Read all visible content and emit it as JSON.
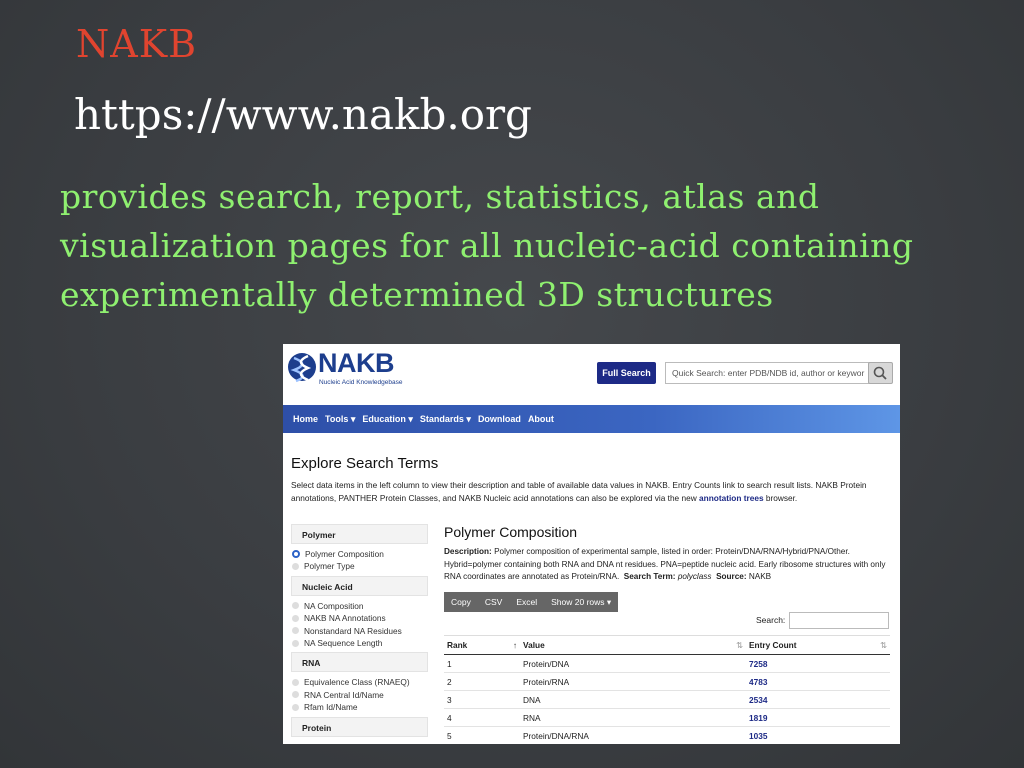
{
  "slide": {
    "title": "NAKB",
    "url": "https://www.nakb.org",
    "description": "provides search, report, statistics, atlas and visualization pages for all nucleic-acid containing experimentally determined 3D structures"
  },
  "app": {
    "logo_text": "NAKB",
    "logo_subtitle": "Nucleic Acid Knowledgebase",
    "full_search_label": "Full Search",
    "quick_search_placeholder": "Quick Search: enter PDB/NDB id, author or keywor",
    "nav": [
      "Home",
      "Tools ▾",
      "Education ▾",
      "Standards ▾",
      "Download",
      "About"
    ],
    "page_title": "Explore Search Terms",
    "intro_text": "Select data items in the left column to view their description and table of available data values in NAKB. Entry Counts link to search result lists. NAKB Protein annotations, PANTHER Protein Classes, and NAKB Nucleic acid annotations can also be explored via the new",
    "intro_link": "annotation trees",
    "intro_suffix": "browser.",
    "sidebar": [
      {
        "heading": "Polymer",
        "items": [
          "Polymer Composition",
          "Polymer Type"
        ]
      },
      {
        "heading": "Nucleic Acid",
        "items": [
          "NA Composition",
          "NAKB NA Annotations",
          "Nonstandard NA Residues",
          "NA Sequence Length"
        ]
      },
      {
        "heading": "RNA",
        "items": [
          "Equivalence Class (RNAEQ)",
          "RNA Central Id/Name",
          "Rfam Id/Name"
        ]
      },
      {
        "heading": "Protein",
        "items": []
      }
    ],
    "selected_item": "Polymer Composition",
    "main": {
      "heading": "Polymer Composition",
      "desc_label": "Description:",
      "desc_text": "Polymer composition of experimental sample, listed in order: Protein/DNA/RNA/Hybrid/PNA/Other. Hybrid=polymer containing both RNA and DNA nt residues. PNA=peptide nucleic acid. Early ribosome structures with only RNA coordinates are annotated as Protein/RNA.",
      "term_label": "Search Term:",
      "term_value": "polyclass",
      "source_label": "Source:",
      "source_value": "NAKB",
      "buttons": [
        "Copy",
        "CSV",
        "Excel",
        "Show 20 rows ▾"
      ],
      "search_label": "Search:",
      "columns": [
        "Rank",
        "Value",
        "Entry Count"
      ],
      "rows": [
        {
          "rank": "1",
          "value": "Protein/DNA",
          "count": "7258"
        },
        {
          "rank": "2",
          "value": "Protein/RNA",
          "count": "4783"
        },
        {
          "rank": "3",
          "value": "DNA",
          "count": "2534"
        },
        {
          "rank": "4",
          "value": "RNA",
          "count": "1819"
        },
        {
          "rank": "5",
          "value": "Protein/DNA/RNA",
          "count": "1035"
        }
      ]
    }
  },
  "colors": {
    "title_red": "#e0442f",
    "desc_green": "#8ff070",
    "nakb_blue": "#1d2a86"
  }
}
